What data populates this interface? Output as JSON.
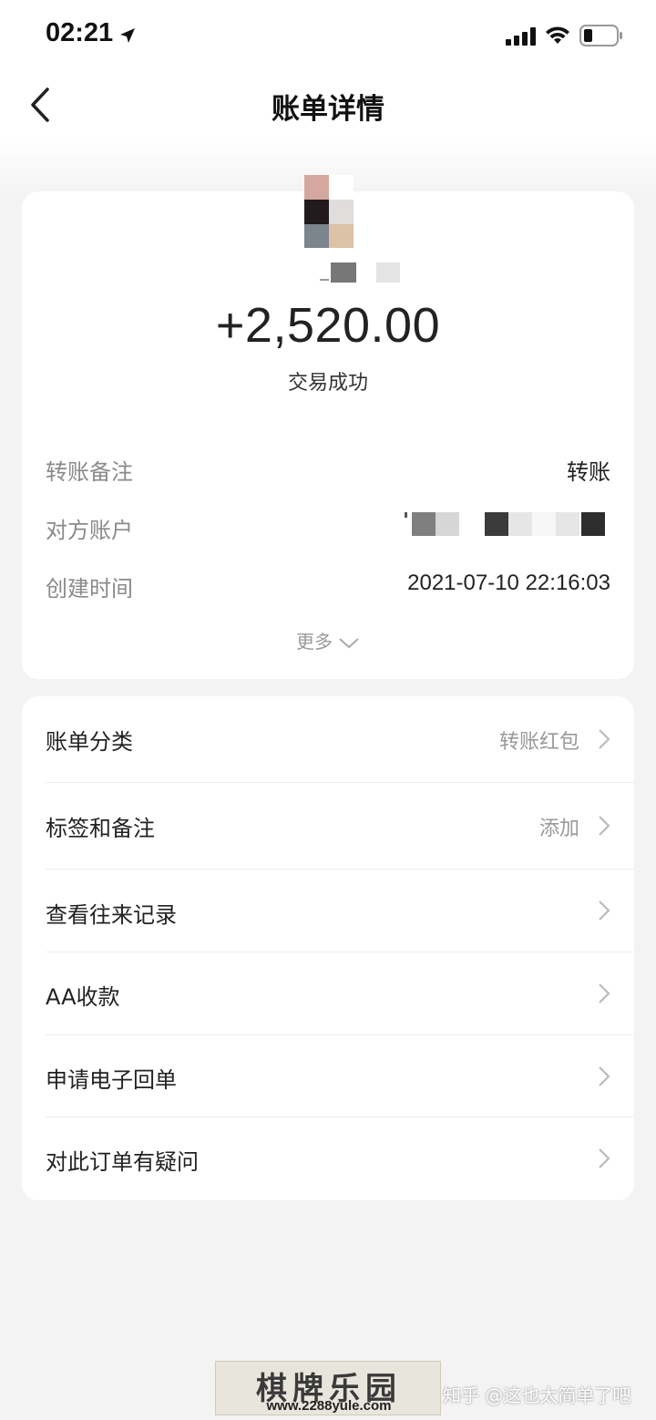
{
  "status_bar": {
    "time": "02:21"
  },
  "nav": {
    "title": "账单详情"
  },
  "summary": {
    "amount": "+2,520.00",
    "status": "交易成功",
    "rows": [
      {
        "label": "转账备注",
        "value": "转账"
      },
      {
        "label": "对方账户",
        "value": ""
      },
      {
        "label": "创建时间",
        "value": "2021-07-10 22:16:03"
      }
    ],
    "more": "更多"
  },
  "menu": [
    {
      "label": "账单分类",
      "value": "转账红包"
    },
    {
      "label": "标签和备注",
      "value": "添加"
    },
    {
      "label": "查看往来记录",
      "value": ""
    },
    {
      "label": "AA收款",
      "value": ""
    },
    {
      "label": "申请电子回单",
      "value": ""
    },
    {
      "label": "对此订单有疑问",
      "value": ""
    }
  ],
  "watermark": {
    "site_name": "棋牌乐园",
    "site_url": "www.2288yule.com",
    "zhihu": "知乎 @这也太简单了吧"
  }
}
